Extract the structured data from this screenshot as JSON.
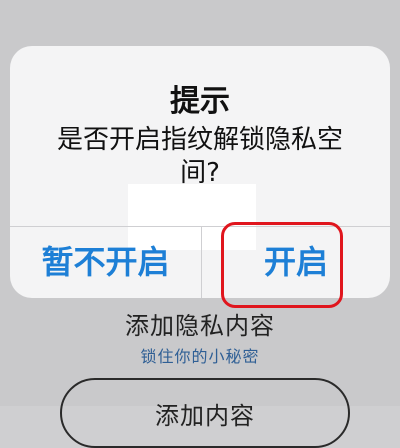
{
  "dialog": {
    "title": "提示",
    "message": "是否开启指纹解锁隐私空间?",
    "cancel_label": "暂不开启",
    "confirm_label": "开启"
  },
  "background": {
    "title": "添加隐私内容",
    "subtitle": "锁住你的小秘密",
    "button_label": "添加内容"
  },
  "colors": {
    "accent": "#1d7fd6",
    "annotation": "#e0151d",
    "subtitle": "#2f5f95"
  }
}
